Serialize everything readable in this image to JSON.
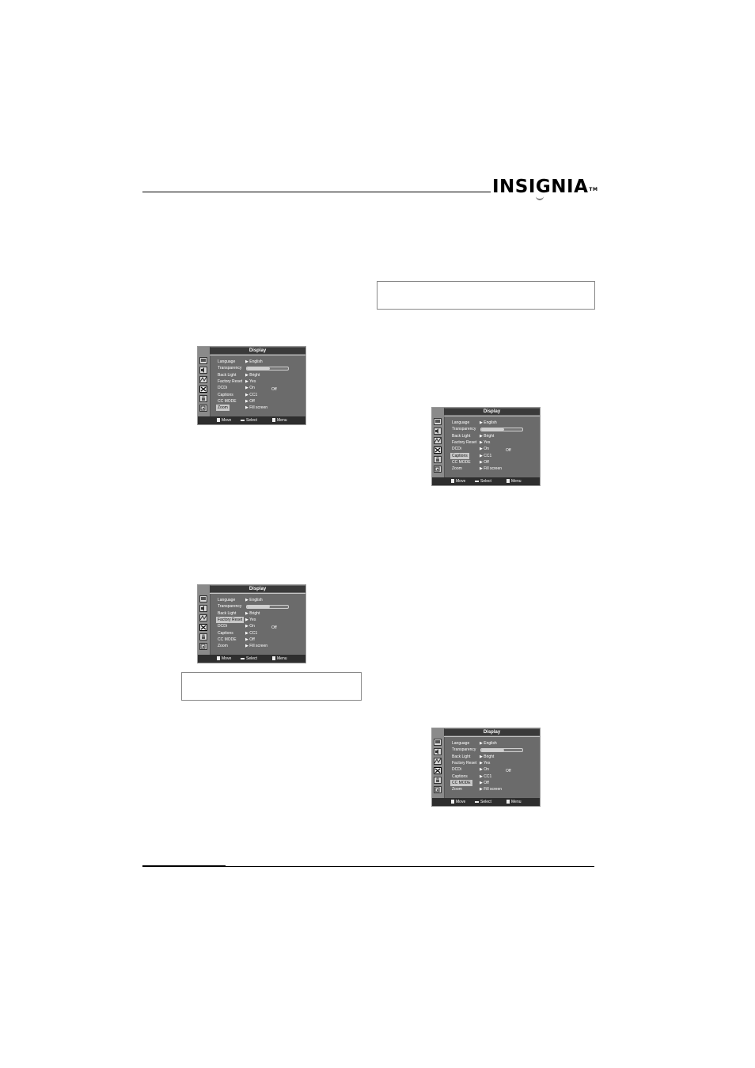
{
  "brand": {
    "logo_text": "INSIGNIA",
    "trademark": "TM"
  },
  "osd_menus": [
    {
      "title": "Display",
      "selected_row": "Zoom",
      "active_icon": "setup-icon",
      "transparency_level": 0.55,
      "items": [
        {
          "label": "Language",
          "value": "English",
          "type": "value"
        },
        {
          "label": "Transparency",
          "value": "",
          "type": "slider"
        },
        {
          "label": "Back Light",
          "value": "Bright",
          "type": "value"
        },
        {
          "label": "Factory Reset",
          "value": "Yes",
          "type": "value"
        },
        {
          "label": "DCDi",
          "value": "On",
          "type": "value"
        },
        {
          "label": "Captions",
          "value": "CC1",
          "type": "value"
        },
        {
          "label": "CC MODE",
          "value": "Off",
          "type": "value"
        },
        {
          "label": "Zoom",
          "value": "Fill screen",
          "type": "value"
        }
      ],
      "side_note": "Off",
      "footer": {
        "move": "Move",
        "select": "Select",
        "exit": "Menu to exit"
      }
    },
    {
      "title": "Display",
      "selected_row": "Captions",
      "active_icon": "setup-icon",
      "transparency_level": 0.55,
      "items": [
        {
          "label": "Language",
          "value": "English",
          "type": "value"
        },
        {
          "label": "Transparency",
          "value": "",
          "type": "slider"
        },
        {
          "label": "Back Light",
          "value": "Bright",
          "type": "value"
        },
        {
          "label": "Factory Reset",
          "value": "Yes",
          "type": "value"
        },
        {
          "label": "DCDi",
          "value": "On",
          "type": "value"
        },
        {
          "label": "Captions",
          "value": "CC1",
          "type": "value"
        },
        {
          "label": "CC MODE",
          "value": "Off",
          "type": "value"
        },
        {
          "label": "Zoom",
          "value": "Fill screen",
          "type": "value"
        }
      ],
      "side_note": "Off",
      "footer": {
        "move": "Move",
        "select": "Select",
        "exit": "Menu to exit"
      }
    },
    {
      "title": "Display",
      "selected_row": "Factory Reset",
      "active_icon": "setup-icon",
      "transparency_level": 0.55,
      "items": [
        {
          "label": "Language",
          "value": "English",
          "type": "value"
        },
        {
          "label": "Transparency",
          "value": "",
          "type": "slider"
        },
        {
          "label": "Back Light",
          "value": "Bright",
          "type": "value"
        },
        {
          "label": "Factory Reset",
          "value": "Yes",
          "type": "value"
        },
        {
          "label": "DCDi",
          "value": "On",
          "type": "value"
        },
        {
          "label": "Captions",
          "value": "CC1",
          "type": "value"
        },
        {
          "label": "CC MODE",
          "value": "Off",
          "type": "value"
        },
        {
          "label": "Zoom",
          "value": "Fill screen",
          "type": "value"
        }
      ],
      "side_note": "Off",
      "footer": {
        "move": "Move",
        "select": "Select",
        "exit": "Menu to exit"
      }
    },
    {
      "title": "Display",
      "selected_row": "CC MODE",
      "active_icon": "setup-icon",
      "transparency_level": 0.55,
      "items": [
        {
          "label": "Language",
          "value": "English",
          "type": "value"
        },
        {
          "label": "Transparency",
          "value": "",
          "type": "slider"
        },
        {
          "label": "Back Light",
          "value": "Bright",
          "type": "value"
        },
        {
          "label": "Factory Reset",
          "value": "Yes",
          "type": "value"
        },
        {
          "label": "DCDi",
          "value": "On",
          "type": "value"
        },
        {
          "label": "Captions",
          "value": "CC1",
          "type": "value"
        },
        {
          "label": "CC MODE",
          "value": "Off",
          "type": "value"
        },
        {
          "label": "Zoom",
          "value": "Fill screen",
          "type": "value"
        }
      ],
      "side_note": "Off",
      "footer": {
        "move": "Move",
        "select": "Select",
        "exit": "Menu to exit"
      }
    }
  ],
  "sidebar_icons": [
    "picture-icon",
    "sound-icon",
    "channel-icon",
    "setup-icon",
    "lock-icon",
    "input-icon"
  ],
  "note_boxes": [
    {
      "text": ""
    },
    {
      "text": ""
    }
  ]
}
